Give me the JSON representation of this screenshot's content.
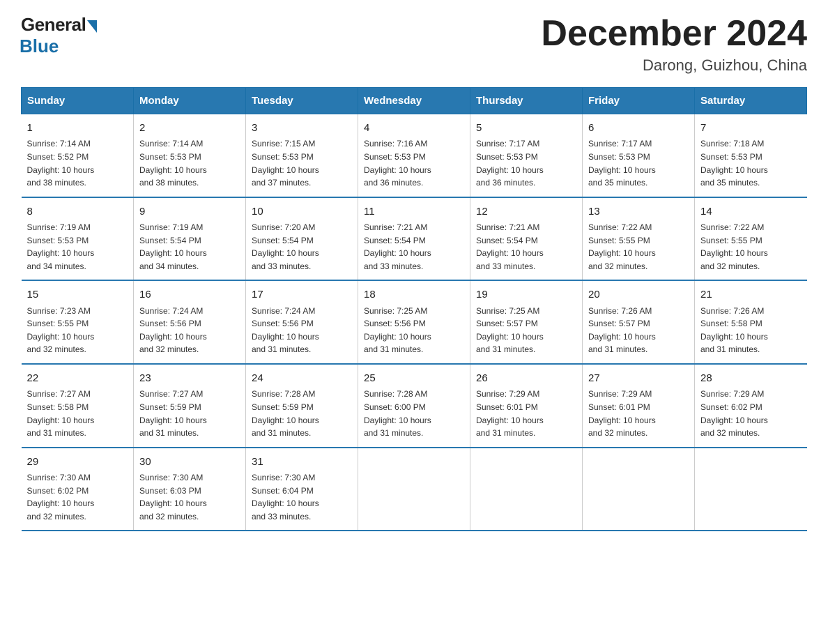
{
  "logo": {
    "general": "General",
    "blue": "Blue"
  },
  "title": "December 2024",
  "location": "Darong, Guizhou, China",
  "days_of_week": [
    "Sunday",
    "Monday",
    "Tuesday",
    "Wednesday",
    "Thursday",
    "Friday",
    "Saturday"
  ],
  "weeks": [
    [
      {
        "day": "1",
        "info": "Sunrise: 7:14 AM\nSunset: 5:52 PM\nDaylight: 10 hours\nand 38 minutes."
      },
      {
        "day": "2",
        "info": "Sunrise: 7:14 AM\nSunset: 5:53 PM\nDaylight: 10 hours\nand 38 minutes."
      },
      {
        "day": "3",
        "info": "Sunrise: 7:15 AM\nSunset: 5:53 PM\nDaylight: 10 hours\nand 37 minutes."
      },
      {
        "day": "4",
        "info": "Sunrise: 7:16 AM\nSunset: 5:53 PM\nDaylight: 10 hours\nand 36 minutes."
      },
      {
        "day": "5",
        "info": "Sunrise: 7:17 AM\nSunset: 5:53 PM\nDaylight: 10 hours\nand 36 minutes."
      },
      {
        "day": "6",
        "info": "Sunrise: 7:17 AM\nSunset: 5:53 PM\nDaylight: 10 hours\nand 35 minutes."
      },
      {
        "day": "7",
        "info": "Sunrise: 7:18 AM\nSunset: 5:53 PM\nDaylight: 10 hours\nand 35 minutes."
      }
    ],
    [
      {
        "day": "8",
        "info": "Sunrise: 7:19 AM\nSunset: 5:53 PM\nDaylight: 10 hours\nand 34 minutes."
      },
      {
        "day": "9",
        "info": "Sunrise: 7:19 AM\nSunset: 5:54 PM\nDaylight: 10 hours\nand 34 minutes."
      },
      {
        "day": "10",
        "info": "Sunrise: 7:20 AM\nSunset: 5:54 PM\nDaylight: 10 hours\nand 33 minutes."
      },
      {
        "day": "11",
        "info": "Sunrise: 7:21 AM\nSunset: 5:54 PM\nDaylight: 10 hours\nand 33 minutes."
      },
      {
        "day": "12",
        "info": "Sunrise: 7:21 AM\nSunset: 5:54 PM\nDaylight: 10 hours\nand 33 minutes."
      },
      {
        "day": "13",
        "info": "Sunrise: 7:22 AM\nSunset: 5:55 PM\nDaylight: 10 hours\nand 32 minutes."
      },
      {
        "day": "14",
        "info": "Sunrise: 7:22 AM\nSunset: 5:55 PM\nDaylight: 10 hours\nand 32 minutes."
      }
    ],
    [
      {
        "day": "15",
        "info": "Sunrise: 7:23 AM\nSunset: 5:55 PM\nDaylight: 10 hours\nand 32 minutes."
      },
      {
        "day": "16",
        "info": "Sunrise: 7:24 AM\nSunset: 5:56 PM\nDaylight: 10 hours\nand 32 minutes."
      },
      {
        "day": "17",
        "info": "Sunrise: 7:24 AM\nSunset: 5:56 PM\nDaylight: 10 hours\nand 31 minutes."
      },
      {
        "day": "18",
        "info": "Sunrise: 7:25 AM\nSunset: 5:56 PM\nDaylight: 10 hours\nand 31 minutes."
      },
      {
        "day": "19",
        "info": "Sunrise: 7:25 AM\nSunset: 5:57 PM\nDaylight: 10 hours\nand 31 minutes."
      },
      {
        "day": "20",
        "info": "Sunrise: 7:26 AM\nSunset: 5:57 PM\nDaylight: 10 hours\nand 31 minutes."
      },
      {
        "day": "21",
        "info": "Sunrise: 7:26 AM\nSunset: 5:58 PM\nDaylight: 10 hours\nand 31 minutes."
      }
    ],
    [
      {
        "day": "22",
        "info": "Sunrise: 7:27 AM\nSunset: 5:58 PM\nDaylight: 10 hours\nand 31 minutes."
      },
      {
        "day": "23",
        "info": "Sunrise: 7:27 AM\nSunset: 5:59 PM\nDaylight: 10 hours\nand 31 minutes."
      },
      {
        "day": "24",
        "info": "Sunrise: 7:28 AM\nSunset: 5:59 PM\nDaylight: 10 hours\nand 31 minutes."
      },
      {
        "day": "25",
        "info": "Sunrise: 7:28 AM\nSunset: 6:00 PM\nDaylight: 10 hours\nand 31 minutes."
      },
      {
        "day": "26",
        "info": "Sunrise: 7:29 AM\nSunset: 6:01 PM\nDaylight: 10 hours\nand 31 minutes."
      },
      {
        "day": "27",
        "info": "Sunrise: 7:29 AM\nSunset: 6:01 PM\nDaylight: 10 hours\nand 32 minutes."
      },
      {
        "day": "28",
        "info": "Sunrise: 7:29 AM\nSunset: 6:02 PM\nDaylight: 10 hours\nand 32 minutes."
      }
    ],
    [
      {
        "day": "29",
        "info": "Sunrise: 7:30 AM\nSunset: 6:02 PM\nDaylight: 10 hours\nand 32 minutes."
      },
      {
        "day": "30",
        "info": "Sunrise: 7:30 AM\nSunset: 6:03 PM\nDaylight: 10 hours\nand 32 minutes."
      },
      {
        "day": "31",
        "info": "Sunrise: 7:30 AM\nSunset: 6:04 PM\nDaylight: 10 hours\nand 33 minutes."
      },
      null,
      null,
      null,
      null
    ]
  ]
}
